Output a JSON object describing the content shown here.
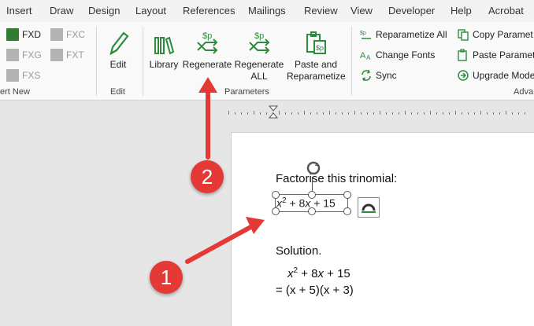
{
  "menu": {
    "tabs": [
      "Insert",
      "Draw",
      "Design",
      "Layout",
      "References",
      "Mailings",
      "Review",
      "View",
      "Developer",
      "Help",
      "Acrobat"
    ]
  },
  "ribbon": {
    "insert_group": {
      "buttons": [
        "FXD",
        "FXC",
        "FXG",
        "FXT",
        "FXS"
      ],
      "label": "ert New"
    },
    "edit_group": {
      "edit_label": "Edit",
      "label": "Edit"
    },
    "parameters_group": {
      "library": "Library",
      "regenerate": "Regenerate",
      "regenerate_all_1": "Regenerate",
      "regenerate_all_2": "ALL",
      "paste_1": "Paste and",
      "paste_2": "Reparametize",
      "label": "Parameters"
    },
    "advanced_group": {
      "reparametize_all": "Reparametize All",
      "change_fonts": "Change Fonts",
      "sync": "Sync",
      "copy_parameters": "Copy Paramet",
      "paste_parameters": "Paste Paramet",
      "upgrade_mode": "Upgrade Mode",
      "label": "Adva"
    },
    "accent": "#2e8b3d"
  },
  "document": {
    "prompt": "Factorise this trinomial:",
    "equation_x": "x",
    "equation_exp": "2",
    "equation_mid": " + 8",
    "equation_x2": "x",
    "equation_end": " + 15",
    "solution_title": "Solution.",
    "solution_line1_x": "x",
    "solution_line1_exp": "2",
    "solution_line1_mid": " + 8",
    "solution_line1_x2": "x",
    "solution_line1_end": " + 15",
    "solution_line2": "= (x + 5)(x + 3)"
  },
  "callouts": {
    "one": "1",
    "two": "2",
    "color": "#e53935"
  }
}
